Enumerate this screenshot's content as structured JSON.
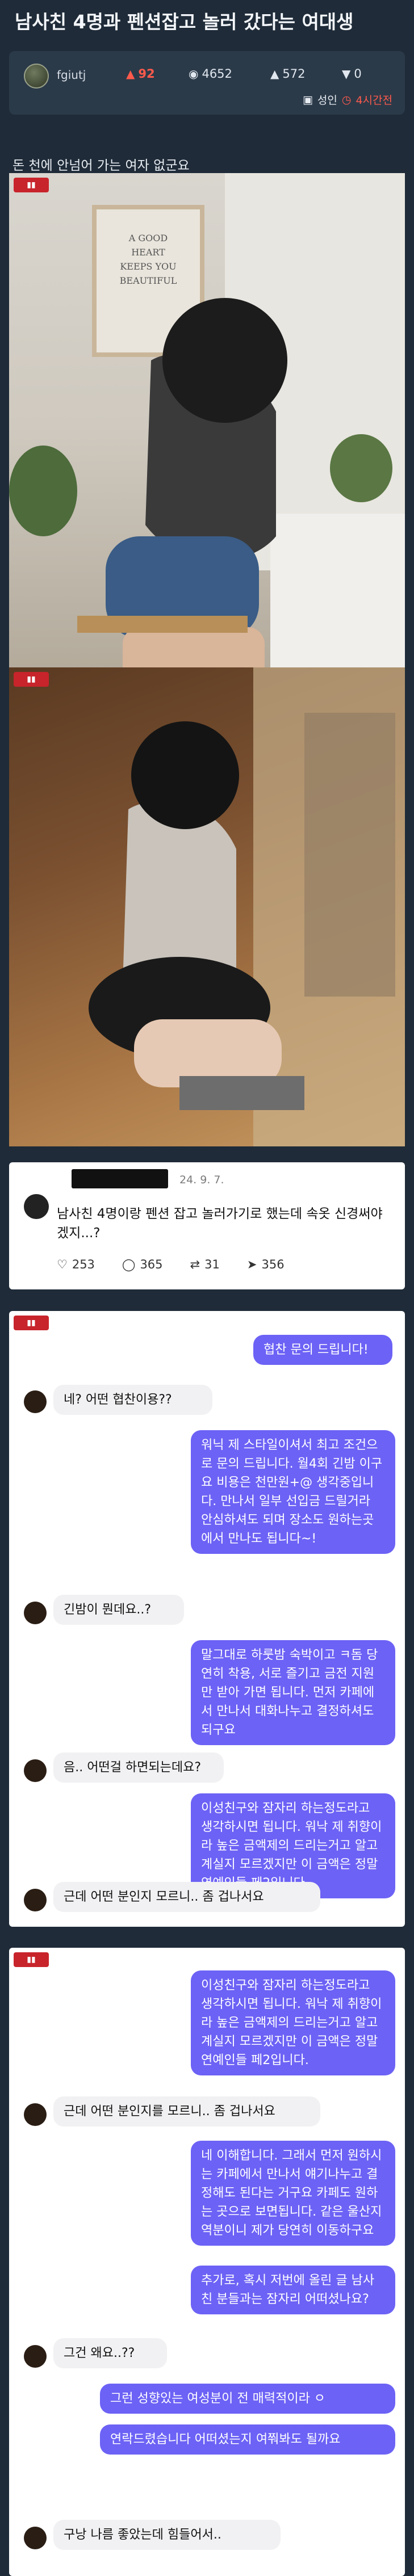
{
  "post": {
    "title": "남사친 4명과 펜션잡고 놀러 갔다는 여대생",
    "author": "fgiutj",
    "fire_icon": "fire-icon",
    "fire": "92",
    "views": "4652",
    "likes": "572",
    "dislikes": "0",
    "category": "성인",
    "time": "4시간전",
    "body_text": "돈 천에 안넘어 가는 여자 없군요",
    "accent_color": "#ff5a4c"
  },
  "photos": {
    "photo1_text": "A GOOD HEART KEEPS YOU BEAUTIFUL"
  },
  "card": {
    "date": "24. 9. 7.",
    "text": "남사친 4명이랑 펜션 잡고 놀러가기로 했는데 속옷 신경써야겠지...?",
    "replies": "253",
    "reposts": "365",
    "likes": "31",
    "shares": "356"
  },
  "chat1": {
    "m1": "협찬 문의 드립니다!",
    "m2": "네? 어떤 협찬이용??",
    "m3": "워닉 제 스타일이셔서 최고 조건으로 문의 드립니다. 월4회 긴밤 이구요 비용은 천만원+@ 생각중입니다. 만나서 일부 선입금 드릴거라 안심하셔도 되며 장소도 원하는곳에서 만나도 됩니다~!",
    "m4": "긴밤이 뭔데요..?",
    "m5": "말그대로 하룻밤 숙박이고 ㅋ돔 당연히 착용, 서로 즐기고 금전 지원만 받아 가면 됩니다. 먼저 카페에서 만나서 대화나누고 결정하셔도 되구요",
    "m6": "음.. 어떤걸 하면되는데요?",
    "m7": "이성친구와 잠자리 하는정도라고 생각하시면 됩니다. 워낙 제 취향이라 높은 금액제의 드리는거고 알고 계실지 모르겠지만 이 금액은 정말 연예인들 페2입니다.",
    "m8": "근데 어떤 분인지 모르니.. 좀 겁나서요"
  },
  "chat2": {
    "m1": "이성친구와 잠자리 하는정도라고 생각하시면 됩니다. 워낙 제 취향이라 높은 금액제의 드리는거고 알고 계실지 모르겠지만 이 금액은 정말 연예인들 페2입니다.",
    "m2": "근데 어떤 분인지를 모르니.. 좀 겁나서요",
    "m3": "네 이해합니다. 그래서 먼저 원하시는 카페에서 만나서 얘기나누고 결정해도 된다는 거구요 카페도 원하는 곳으로 보면됩니다. 같은 울산지역분이니 제가 당연히 이동하구요",
    "m4": "추가로, 혹시 저번에 올린 글 남사친 분들과는 잠자리 어떠셨나요?",
    "m5": "그건 왜요..??",
    "m6": "그런 성향있는 여성분이 전 매력적이라 ㅇ",
    "m7": "연락드렸습니다 어떠셨는지 여쭤봐도 될까요",
    "m8": "구낭 나름 좋았는데 힘들어서.."
  }
}
